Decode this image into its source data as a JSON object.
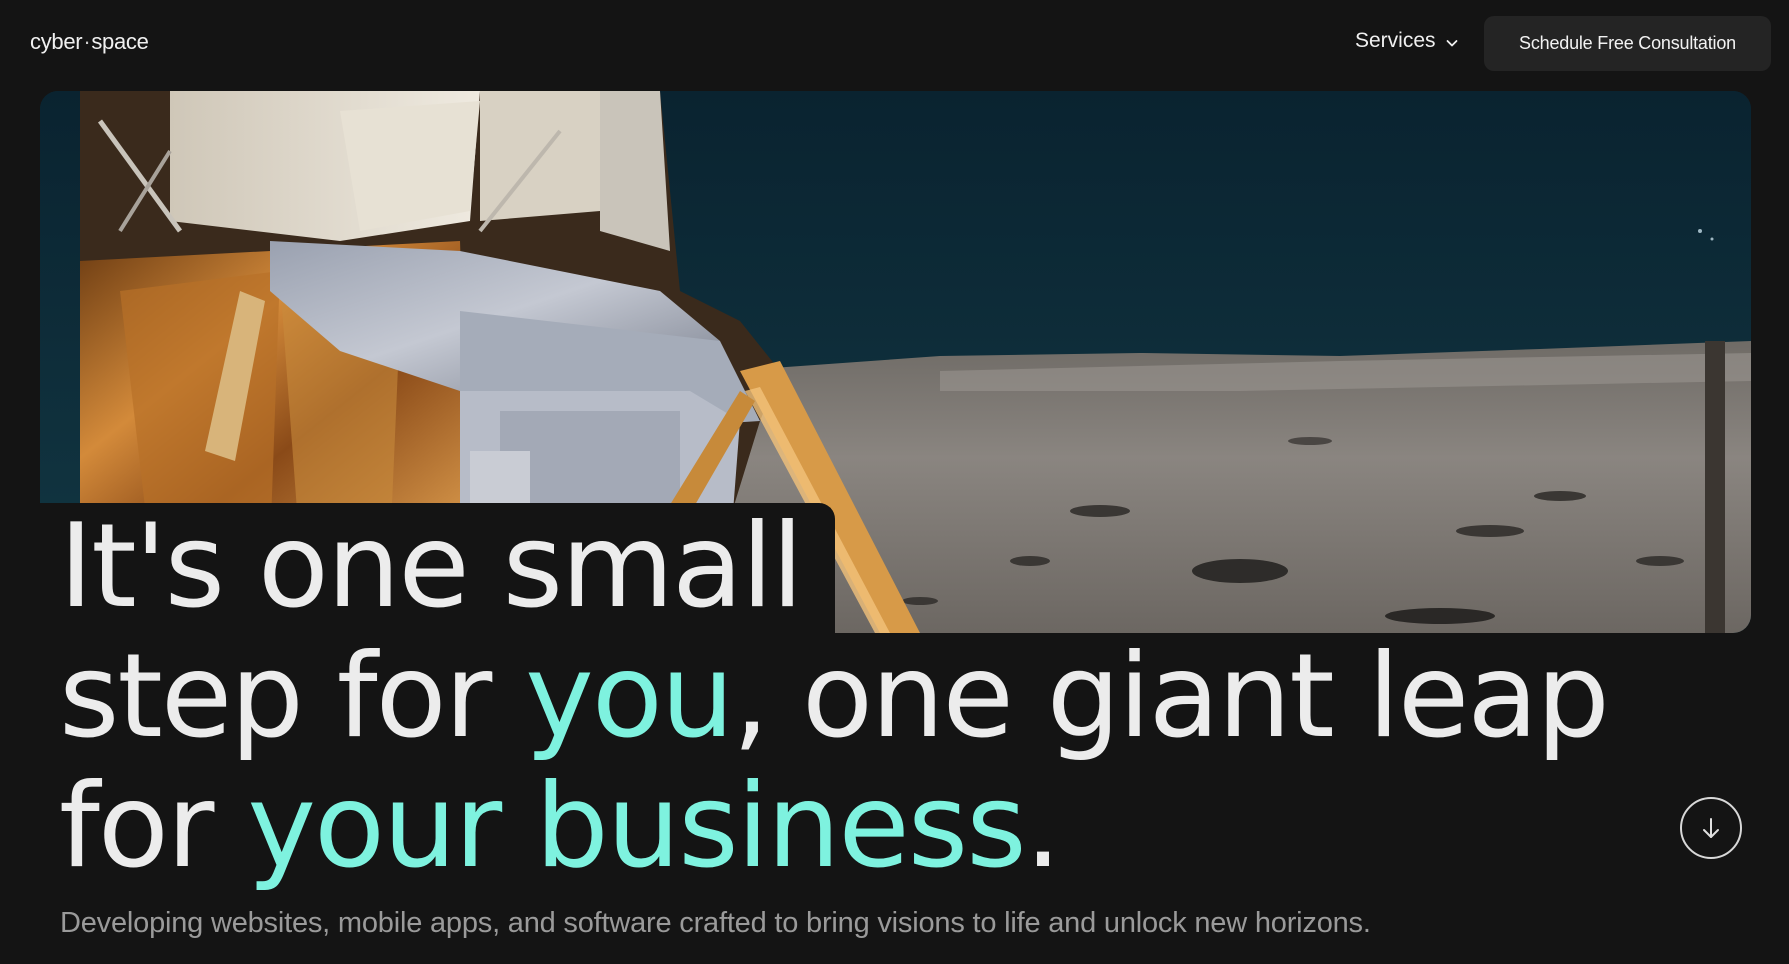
{
  "nav": {
    "logo_part1": "cyber",
    "logo_sep": "·",
    "logo_part2": "space",
    "services_label": "Services",
    "services_icon": "chevron-down-icon",
    "cta_label": "Schedule Free Consultation"
  },
  "hero": {
    "image_icon": "moon-landing-photo",
    "headline": {
      "line1": "It's one small",
      "line2_a": "step for ",
      "line2_hl": "you",
      "line2_b": ", one giant leap",
      "line3_a": "for ",
      "line3_hl": "your business",
      "line3_b": "."
    },
    "subtitle": "Developing websites, mobile apps, and software crafted to bring visions to life and unlock new horizons.",
    "scroll_icon": "arrow-down-icon"
  },
  "colors": {
    "background": "#141414",
    "accent": "#7ef2df",
    "button_bg": "#242424",
    "text": "#ececec",
    "muted_text": "#9a9a9a"
  }
}
